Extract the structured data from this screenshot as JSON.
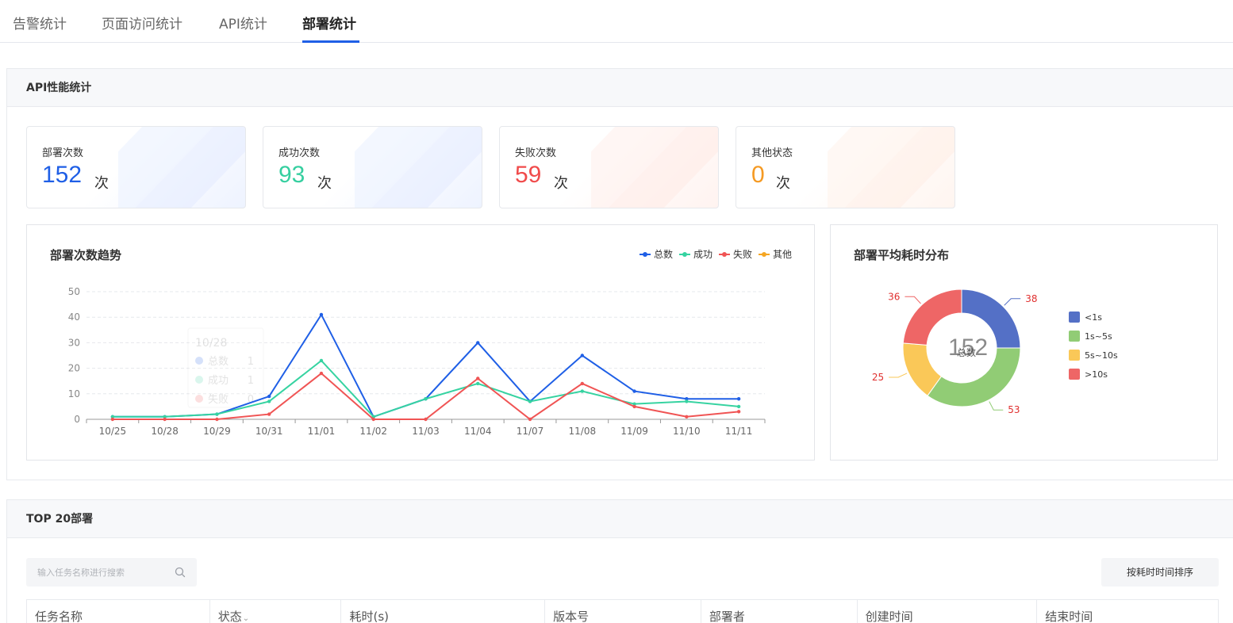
{
  "tabs": [
    {
      "label": "告警统计",
      "active": false
    },
    {
      "label": "页面访问统计",
      "active": false
    },
    {
      "label": "API统计",
      "active": false
    },
    {
      "label": "部署统计",
      "active": true
    }
  ],
  "api_section": {
    "title": "API性能统计"
  },
  "stats": [
    {
      "label": "部署次数",
      "value": "152",
      "unit": "次",
      "color": "#1f5fe6"
    },
    {
      "label": "成功次数",
      "value": "93",
      "unit": "次",
      "color": "#36cfa0"
    },
    {
      "label": "失败次数",
      "value": "59",
      "unit": "次",
      "color": "#f04b4b"
    },
    {
      "label": "其他状态",
      "value": "0",
      "unit": "次",
      "color": "#f59a23"
    }
  ],
  "chart_data": [
    {
      "type": "line",
      "title": "部署次数趋势",
      "x": [
        "10/25",
        "10/28",
        "10/29",
        "10/31",
        "11/01",
        "11/02",
        "11/03",
        "11/04",
        "11/07",
        "11/08",
        "11/09",
        "11/10",
        "11/11"
      ],
      "ylim": [
        0,
        50
      ],
      "yticks": [
        0,
        10,
        20,
        30,
        40,
        50
      ],
      "grid": true,
      "legend": "top-right",
      "series": [
        {
          "name": "总数",
          "color": "#1f5fe6",
          "values": [
            1,
            1,
            2,
            9,
            41,
            1,
            8,
            30,
            7,
            25,
            11,
            8,
            8
          ]
        },
        {
          "name": "成功",
          "color": "#36d3a1",
          "values": [
            1,
            1,
            2,
            7,
            23,
            1,
            8,
            14,
            7,
            11,
            6,
            7,
            5
          ]
        },
        {
          "name": "失败",
          "color": "#f05454",
          "values": [
            0,
            0,
            0,
            2,
            18,
            0,
            0,
            16,
            0,
            14,
            5,
            1,
            3
          ]
        },
        {
          "name": "其他",
          "color": "#f5a623",
          "values": [
            0,
            0,
            0,
            0,
            0,
            0,
            0,
            0,
            0,
            0,
            0,
            0,
            0
          ]
        }
      ],
      "tooltip": {
        "title": "10/28",
        "items": [
          {
            "name": "总数",
            "value": "1"
          },
          {
            "name": "成功",
            "value": "1"
          },
          {
            "name": "失败",
            "value": "0"
          }
        ]
      }
    },
    {
      "type": "pie",
      "title": "部署平均耗时分布",
      "center_value": "152",
      "center_label": "总数",
      "slices": [
        {
          "label": "<1s",
          "value": 38,
          "color": "#5470c6"
        },
        {
          "label": "1s~5s",
          "value": 53,
          "color": "#91cc75"
        },
        {
          "label": "5s~10s",
          "value": 25,
          "color": "#fac858"
        },
        {
          "label": ">10s",
          "value": 36,
          "color": "#ee6666"
        }
      ],
      "legend": "right"
    }
  ],
  "top20": {
    "title": "TOP 20部署",
    "search_placeholder": "输入任务名称进行搜索",
    "sort_label": "按耗时时间排序",
    "columns": [
      "任务名称",
      "状态",
      "耗时(s)",
      "版本号",
      "部署者",
      "创建时间",
      "结束时间"
    ]
  }
}
